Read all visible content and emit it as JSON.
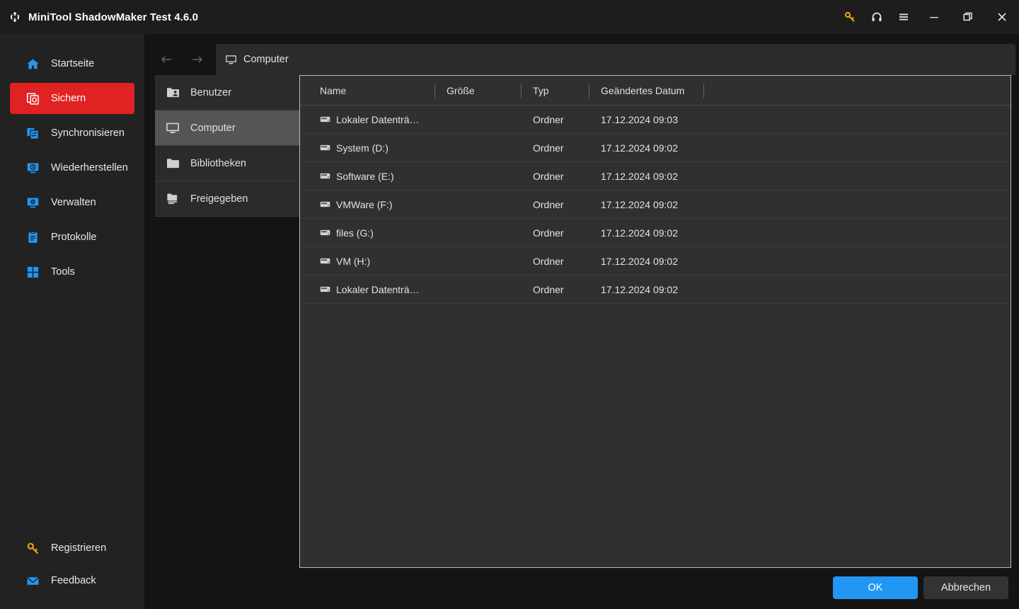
{
  "window": {
    "title": "MiniTool ShadowMaker Test 4.6.0",
    "logo_icon": "refresh-circular-arrows-icon",
    "controls": [
      {
        "name": "license-key-button",
        "icon": "key-icon",
        "color": "#f2a900"
      },
      {
        "name": "support-button",
        "icon": "headset-icon",
        "color": "#e6e6e6"
      },
      {
        "name": "menu-button",
        "icon": "hamburger-menu-icon",
        "color": "#e6e6e6"
      },
      {
        "name": "minimize-button",
        "icon": "minimize-icon",
        "color": "#e6e6e6"
      },
      {
        "name": "restore-button",
        "icon": "restore-window-icon",
        "color": "#e6e6e6"
      },
      {
        "name": "close-button",
        "icon": "close-icon",
        "color": "#e6e6e6"
      }
    ]
  },
  "sidebar": {
    "active_color": "#e02222",
    "items": [
      {
        "label": "Startseite",
        "icon": "home-icon",
        "active": false
      },
      {
        "label": "Sichern",
        "icon": "backup-icon",
        "active": true
      },
      {
        "label": "Synchronisieren",
        "icon": "sync-icon",
        "active": false
      },
      {
        "label": "Wiederherstellen",
        "icon": "restore-icon",
        "active": false
      },
      {
        "label": "Verwalten",
        "icon": "manage-icon",
        "active": false
      },
      {
        "label": "Protokolle",
        "icon": "logs-icon",
        "active": false
      },
      {
        "label": "Tools",
        "icon": "tools-icon",
        "active": false
      }
    ],
    "bottom_items": [
      {
        "label": "Registrieren",
        "icon": "key-icon",
        "color": "#f2a900"
      },
      {
        "label": "Feedback",
        "icon": "envelope-icon",
        "color": "#2196f3"
      }
    ]
  },
  "browser": {
    "back_icon": "arrow-left-icon",
    "forward_icon": "arrow-right-icon",
    "breadcrumb": {
      "icon": "monitor-icon",
      "label": "Computer"
    },
    "tree": [
      {
        "label": "Benutzer",
        "icon": "user-folder-icon",
        "active": false
      },
      {
        "label": "Computer",
        "icon": "monitor-icon",
        "active": true
      },
      {
        "label": "Bibliotheken",
        "icon": "folder-icon",
        "active": false
      },
      {
        "label": "Freigegeben",
        "icon": "shared-folder-icon",
        "active": false
      }
    ],
    "table": {
      "columns": [
        "Name",
        "Größe",
        "Typ",
        "Geändertes Datum"
      ],
      "rows": [
        {
          "name": "Lokaler Datenträ…",
          "size": "",
          "type": "Ordner",
          "date": "17.12.2024 09:03",
          "icon": "drive-icon"
        },
        {
          "name": "System (D:)",
          "size": "",
          "type": "Ordner",
          "date": "17.12.2024 09:02",
          "icon": "drive-icon"
        },
        {
          "name": "Software (E:)",
          "size": "",
          "type": "Ordner",
          "date": "17.12.2024 09:02",
          "icon": "drive-icon"
        },
        {
          "name": "VMWare (F:)",
          "size": "",
          "type": "Ordner",
          "date": "17.12.2024 09:02",
          "icon": "drive-icon"
        },
        {
          "name": "files (G:)",
          "size": "",
          "type": "Ordner",
          "date": "17.12.2024 09:02",
          "icon": "drive-icon"
        },
        {
          "name": "VM (H:)",
          "size": "",
          "type": "Ordner",
          "date": "17.12.2024 09:02",
          "icon": "drive-icon"
        },
        {
          "name": "Lokaler Datenträ…",
          "size": "",
          "type": "Ordner",
          "date": "17.12.2024 09:02",
          "icon": "drive-icon"
        }
      ]
    }
  },
  "footer": {
    "ok_label": "OK",
    "cancel_label": "Abbrechen",
    "ok_color": "#2196f3"
  }
}
